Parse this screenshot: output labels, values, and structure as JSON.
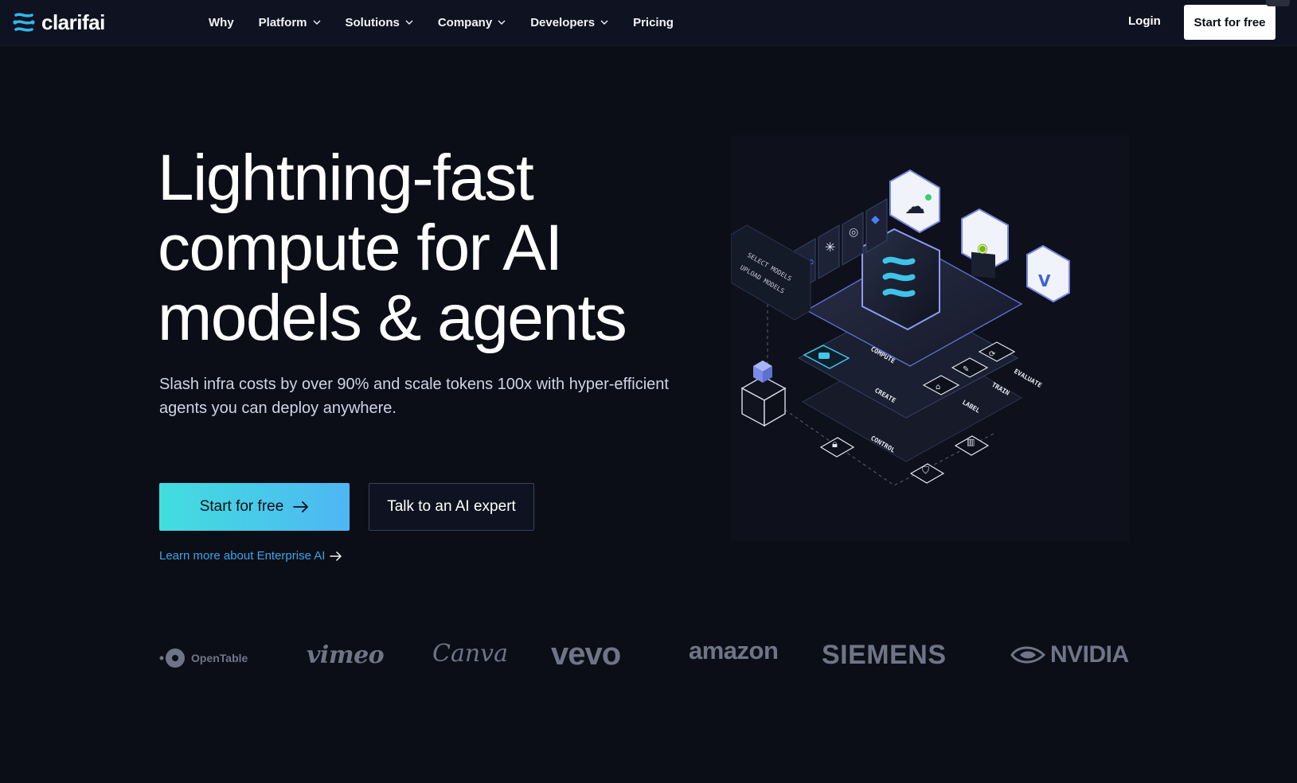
{
  "brand": {
    "name": "clarifai"
  },
  "nav": {
    "items": [
      {
        "label": "Why",
        "dropdown": false
      },
      {
        "label": "Platform",
        "dropdown": true
      },
      {
        "label": "Solutions",
        "dropdown": true
      },
      {
        "label": "Company",
        "dropdown": true
      },
      {
        "label": "Developers",
        "dropdown": true
      },
      {
        "label": "Pricing",
        "dropdown": false
      }
    ],
    "login": "Login",
    "cta": "Start for free"
  },
  "hero": {
    "headline": "Lightning-fast compute for AI models & agents",
    "subtext": "Slash infra costs by over 90% and scale tokens 100x with hyper-efficient agents you can deploy anywhere.",
    "primary_cta": "Start for free",
    "secondary_cta": "Talk to an AI expert",
    "enterprise_link": "Learn more about Enterprise AI"
  },
  "illustration": {
    "labels": {
      "select_models": "SELECT MODELS",
      "upload_models": "UPLOAD MODELS",
      "compute": "COMPUTE",
      "create": "CREATE",
      "control": "CONTROL",
      "evaluate": "EVALUATE",
      "train": "TRAIN",
      "label": "LABEL"
    }
  },
  "customers": [
    "OpenTable",
    "vimeo",
    "Canva",
    "vevo",
    "amazon",
    "SIEMENS",
    "NVIDIA"
  ],
  "colors": {
    "background": "#0c0e17",
    "accent_start": "#41dede",
    "accent_end": "#4fb6f4",
    "link": "#3aa5e8",
    "brand_logo": "#6f7587"
  }
}
